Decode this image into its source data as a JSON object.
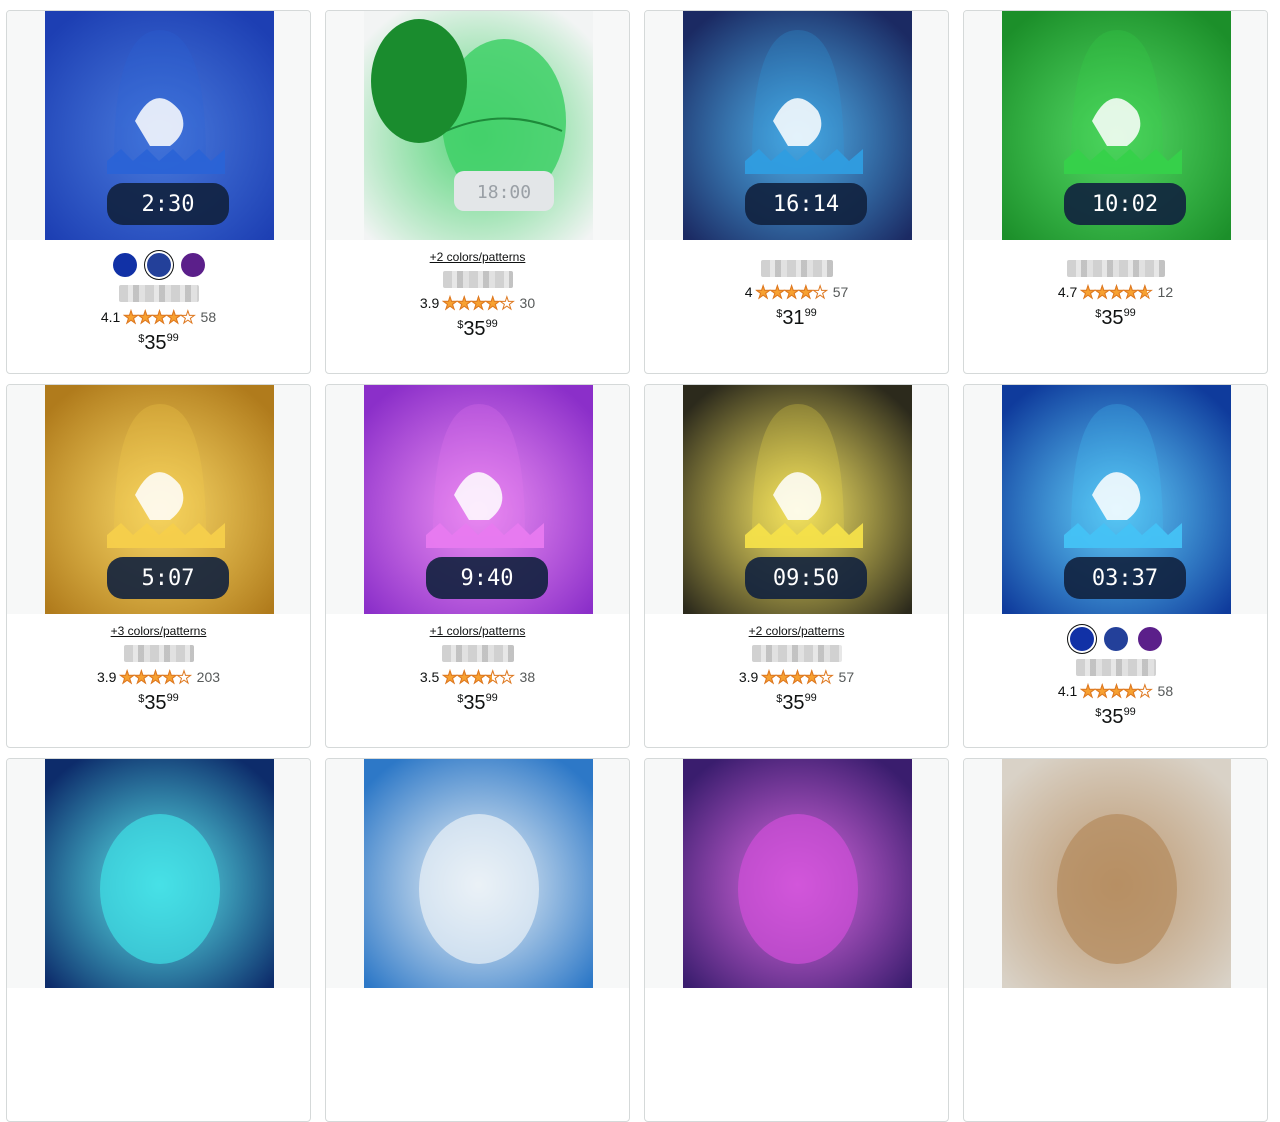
{
  "products": [
    {
      "variant_label": "",
      "swatches": [
        "#1131a6",
        "#23409a",
        "#5b1f8a"
      ],
      "selected": 1,
      "rating": "4.1",
      "rating_value": 4.1,
      "reviews": "58",
      "price_dollars": "35",
      "price_cents": "99",
      "scene": "egg-dino-blue",
      "clock": "2:30",
      "glow": "#2a63d6",
      "bg": "#1d3fb3",
      "blur_w": 80
    },
    {
      "variant_label": "+2 colors/patterns",
      "swatches": [],
      "selected": -1,
      "rating": "3.9",
      "rating_value": 3.9,
      "reviews": "30",
      "price_dollars": "35",
      "price_cents": "99",
      "scene": "egg-green",
      "clock": "18:00",
      "glow": "#3fd067",
      "bg": "#f2f4f4",
      "blur_w": 70
    },
    {
      "variant_label": "",
      "swatches": [],
      "selected": -1,
      "rating": "4",
      "rating_value": 4.0,
      "reviews": "57",
      "price_dollars": "31",
      "price_cents": "99",
      "scene": "dino-white-egg",
      "clock": "16:14",
      "glow": "#2f9de0",
      "bg": "#1b2a63",
      "blur_w": 72
    },
    {
      "variant_label": "",
      "swatches": [],
      "selected": -1,
      "rating": "4.7",
      "rating_value": 4.7,
      "reviews": "12",
      "price_dollars": "35",
      "price_cents": "99",
      "scene": "trex-green",
      "clock": "10:02",
      "glow": "#36d14a",
      "bg": "#1c8f2a",
      "blur_w": 98
    },
    {
      "variant_label": "+3 colors/patterns",
      "swatches": [],
      "selected": -1,
      "rating": "3.9",
      "rating_value": 3.9,
      "reviews": "203",
      "price_dollars": "35",
      "price_cents": "99",
      "scene": "dino-yellow",
      "clock": "5:07",
      "glow": "#f6cf4b",
      "bg": "#b07b1c",
      "blur_w": 70
    },
    {
      "variant_label": "+1 colors/patterns",
      "swatches": [],
      "selected": -1,
      "rating": "3.5",
      "rating_value": 3.5,
      "reviews": "38",
      "price_dollars": "35",
      "price_cents": "99",
      "scene": "butterfly-purple",
      "clock": "9:40",
      "glow": "#e87af0",
      "bg": "#8b2fc9",
      "blur_w": 72
    },
    {
      "variant_label": "+2 colors/patterns",
      "swatches": [],
      "selected": -1,
      "rating": "3.9",
      "rating_value": 3.9,
      "reviews": "57",
      "price_dollars": "35",
      "price_cents": "99",
      "scene": "lizard-yellow",
      "clock": "09:50",
      "glow": "#f4e04a",
      "bg": "#2c2a1c",
      "blur_w": 90
    },
    {
      "variant_label": "",
      "swatches": [
        "#1131a6",
        "#23409a",
        "#5b1f8a"
      ],
      "selected": 0,
      "rating": "4.1",
      "rating_value": 4.1,
      "reviews": "58",
      "price_dollars": "35",
      "price_cents": "99",
      "scene": "dino-blue",
      "clock": "03:37",
      "glow": "#44c2f5",
      "bg": "#0f3b9c",
      "blur_w": 80
    },
    {
      "variant_label": "",
      "swatches": [],
      "selected": -1,
      "rating": "",
      "rating_value": 0,
      "reviews": "",
      "price_dollars": "",
      "price_cents": "",
      "scene": "dragon-cyan",
      "clock": "",
      "glow": "#3fe0e6",
      "bg": "#0d2c6b",
      "blur_w": 0
    },
    {
      "variant_label": "",
      "swatches": [],
      "selected": -1,
      "rating": "",
      "rating_value": 0,
      "reviews": "",
      "price_dollars": "",
      "price_cents": "",
      "scene": "egg-galaxy",
      "clock": "",
      "glow": "#eaf1f6",
      "bg": "#2d78c7",
      "blur_w": 0
    },
    {
      "variant_label": "",
      "swatches": [],
      "selected": -1,
      "rating": "",
      "rating_value": 0,
      "reviews": "",
      "price_dollars": "",
      "price_cents": "",
      "scene": "galaxy-projector",
      "clock": "",
      "glow": "#d04fd9",
      "bg": "#3a1d6e",
      "blur_w": 0
    },
    {
      "variant_label": "",
      "swatches": [],
      "selected": -1,
      "rating": "",
      "rating_value": 0,
      "reviews": "",
      "price_dollars": "",
      "price_cents": "",
      "scene": "box-room",
      "clock": "",
      "glow": "#b48a5c",
      "bg": "#d9d2c7",
      "blur_w": 0
    }
  ],
  "currency_symbol": "$",
  "star_glyphs": "★★★★★"
}
